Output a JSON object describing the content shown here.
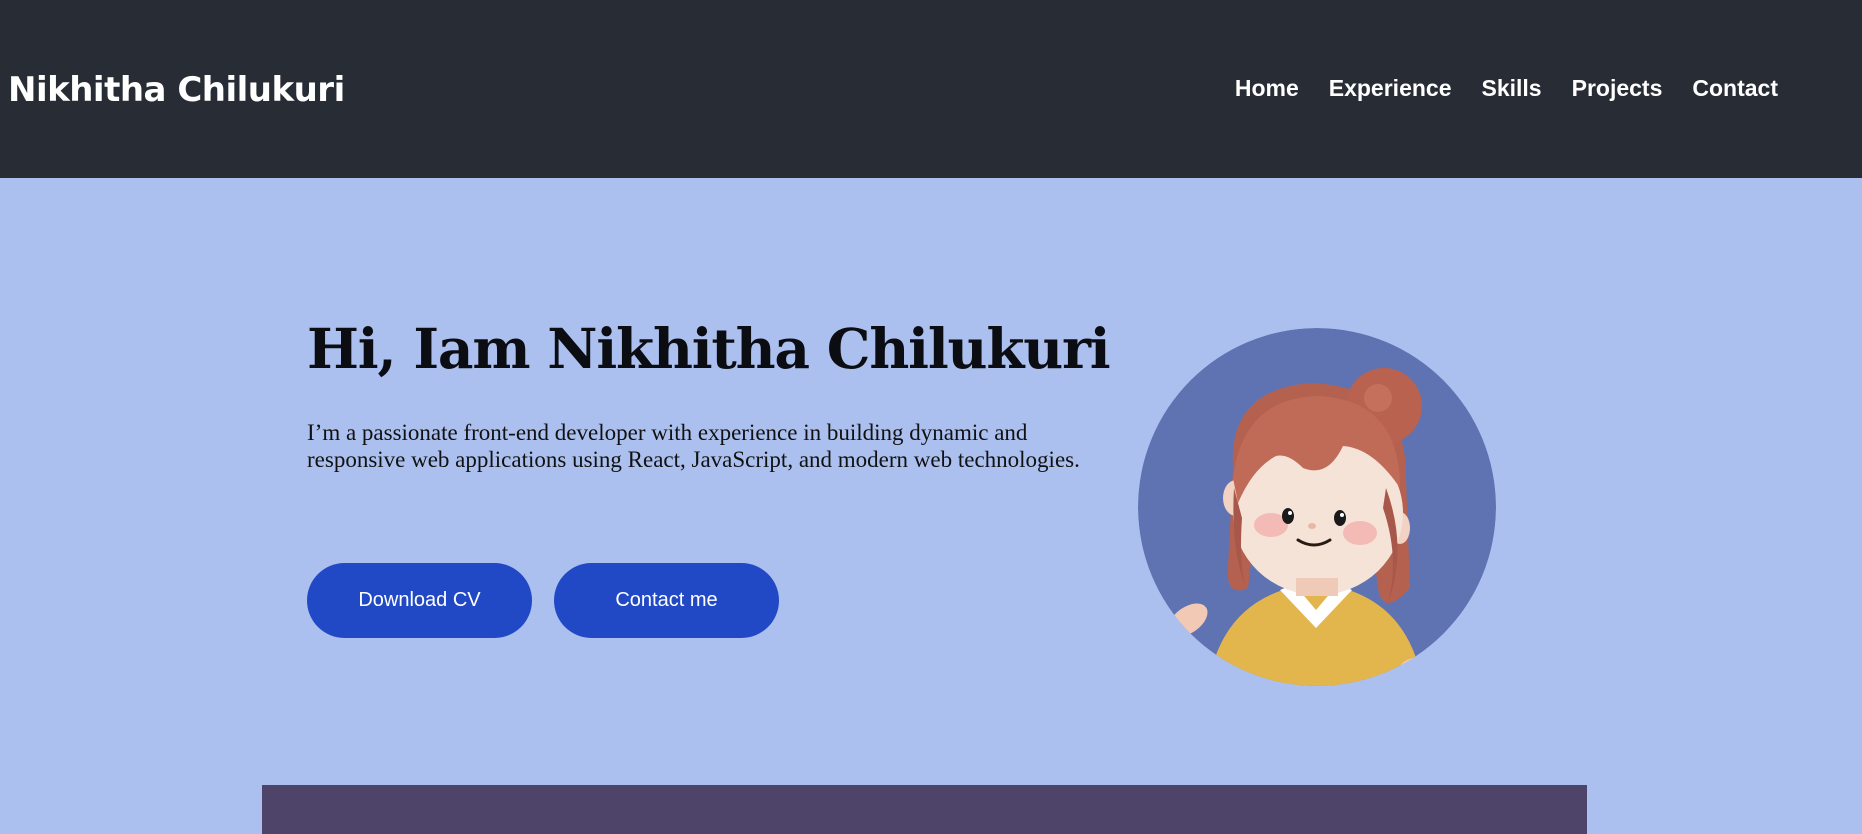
{
  "header": {
    "brand": "Nikhitha Chilukuri",
    "nav": [
      {
        "label": "Home"
      },
      {
        "label": "Experience"
      },
      {
        "label": "Skills"
      },
      {
        "label": "Projects"
      },
      {
        "label": "Contact"
      }
    ]
  },
  "hero": {
    "title": "Hi, Iam Nikhitha Chilukuri",
    "description": "I’m a passionate front-end developer with experience in building dynamic and responsive web applications using React, JavaScript, and modern web technologies.",
    "buttons": {
      "download_cv": "Download CV",
      "contact_me": "Contact me"
    },
    "avatar_icon": "cartoon-girl-avatar-icon"
  },
  "colors": {
    "navbar_bg": "#282c35",
    "hero_bg": "#abc0ee",
    "button_bg": "#2149c5",
    "avatar_circle": "#5f73b3",
    "next_section_bg": "#4e4369"
  }
}
